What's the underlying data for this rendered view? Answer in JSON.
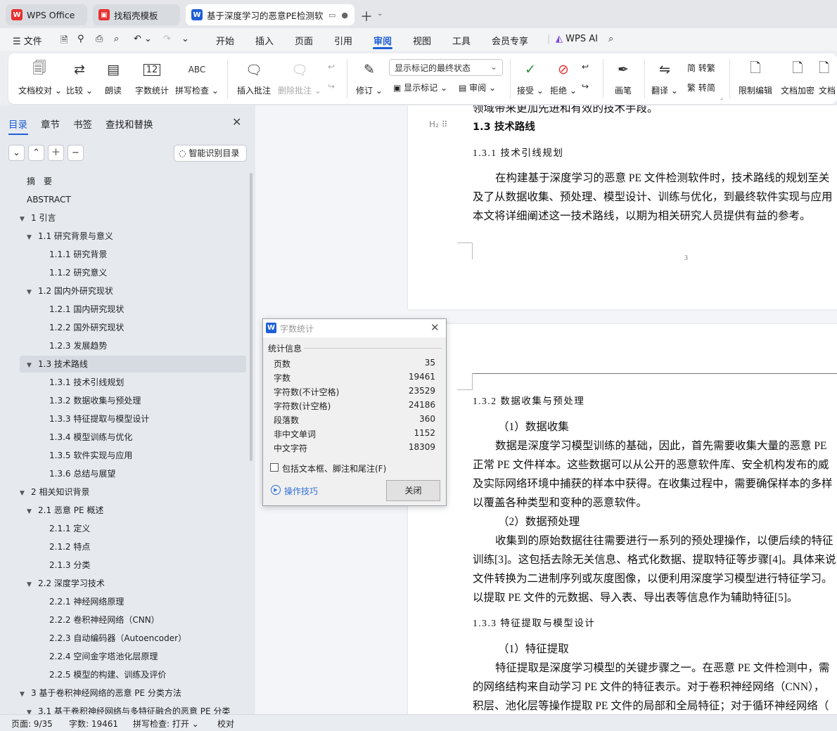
{
  "tabs": [
    {
      "label": "WPS Office"
    },
    {
      "label": "找稻壳模板"
    },
    {
      "label": "基于深度学习的恶意PE检测软"
    }
  ],
  "menu": {
    "file": "文件",
    "items": [
      "开始",
      "插入",
      "页面",
      "引用",
      "审阅",
      "视图",
      "工具",
      "会员专享"
    ],
    "active": "审阅",
    "ai": "WPS AI"
  },
  "ribbon": {
    "doc_proof": "文档校对",
    "compare": "比较",
    "read_aloud": "朗读",
    "word_count": "字数统计",
    "spell_check": "拼写检查",
    "spell_icon_text": "ABC",
    "count_icon_text": "12",
    "insert_comment": "插入批注",
    "delete_comment": "删除批注",
    "revise": "修订",
    "view_select": "显示标记的最终状态",
    "show_markup": "显示标记",
    "review": "审阅",
    "accept": "接受",
    "reject": "拒绝",
    "pen": "画笔",
    "translate": "翻译",
    "to_trad": "转繁",
    "to_simp": "转简",
    "trad_icon": "简",
    "simp_icon": "繁",
    "restrict_edit": "限制编辑",
    "encrypt": "文档加密",
    "doc_more": "文档"
  },
  "panel": {
    "tabs": [
      "目录",
      "章节",
      "书签",
      "查找和替换"
    ],
    "smart_button": "智能识别目录",
    "toc": [
      {
        "text": "摘　要",
        "level": 0,
        "toggle": ""
      },
      {
        "text": "ABSTRACT",
        "level": 0,
        "toggle": ""
      },
      {
        "text": "1  引言",
        "level": 0,
        "toggle": "▼"
      },
      {
        "text": "1.1  研究背景与意义",
        "level": 1,
        "toggle": "▼"
      },
      {
        "text": "1.1.1  研究背景",
        "level": 2,
        "toggle": ""
      },
      {
        "text": "1.1.2  研究意义",
        "level": 2,
        "toggle": ""
      },
      {
        "text": "1.2  国内外研究现状",
        "level": 1,
        "toggle": "▼"
      },
      {
        "text": "1.2.1  国内研究现状",
        "level": 2,
        "toggle": ""
      },
      {
        "text": "1.2.2 国外研究现状",
        "level": 2,
        "toggle": ""
      },
      {
        "text": "1.2.3 发展趋势",
        "level": 2,
        "toggle": ""
      },
      {
        "text": "1.3  技术路线",
        "level": 1,
        "toggle": "▼",
        "selected": true
      },
      {
        "text": "1.3.1  技术引线规划",
        "level": 2,
        "toggle": ""
      },
      {
        "text": "1.3.2  数据收集与预处理",
        "level": 2,
        "toggle": ""
      },
      {
        "text": "1.3.3  特征提取与模型设计",
        "level": 2,
        "toggle": ""
      },
      {
        "text": "1.3.4  模型训练与优化",
        "level": 2,
        "toggle": ""
      },
      {
        "text": "1.3.5  软件实现与应用",
        "level": 2,
        "toggle": ""
      },
      {
        "text": "1.3.6  总结与展望",
        "level": 2,
        "toggle": ""
      },
      {
        "text": "2  相关知识背景",
        "level": 0,
        "toggle": "▼"
      },
      {
        "text": "2.1  恶意 PE 概述",
        "level": 1,
        "toggle": "▼"
      },
      {
        "text": "2.1.1  定义",
        "level": 2,
        "toggle": ""
      },
      {
        "text": "2.1.2  特点",
        "level": 2,
        "toggle": ""
      },
      {
        "text": "2.1.3  分类",
        "level": 2,
        "toggle": ""
      },
      {
        "text": "2.2  深度学习技术",
        "level": 1,
        "toggle": "▼"
      },
      {
        "text": "2.2.1  神经网络原理",
        "level": 2,
        "toggle": ""
      },
      {
        "text": "2.2.2  卷积神经网络（CNN）",
        "level": 2,
        "toggle": ""
      },
      {
        "text": "2.2.3  自动编码器（Autoencoder）",
        "level": 2,
        "toggle": ""
      },
      {
        "text": "2.2.4  空间金字塔池化层原理",
        "level": 2,
        "toggle": ""
      },
      {
        "text": "2.2.5  模型的构建、训练及评价",
        "level": 2,
        "toggle": ""
      },
      {
        "text": "3  基于卷积神经网络的恶意 PE 分类方法",
        "level": 0,
        "toggle": "▼"
      },
      {
        "text": "3.1  基于卷积神经网络与多特征融合的恶意 PE 分类",
        "level": 1,
        "toggle": "▼"
      }
    ]
  },
  "document": {
    "page1": {
      "top_line": "领域带来更加先进和有效的技术手段。",
      "heading_mark": "H₂",
      "h13": "1.3  技术路线",
      "h131": "1.3.1 技术引线规划",
      "lines": [
        "在构建基于深度学习的恶意 PE 文件检测软件时，技术路线的规划至关",
        "及了从数据收集、预处理、模型设计、训练与优化，到最终软件实现与应用",
        "本文将详细阐述这一技术路线，以期为相关研究人员提供有益的参考。"
      ],
      "page_number": "3"
    },
    "page2": {
      "h132": "1.3.2 数据收集与预处理",
      "p1_title": "（1）数据收集",
      "p1_lines": [
        "数据是深度学习模型训练的基础，因此，首先需要收集大量的恶意 PE",
        "正常 PE 文件样本。这些数据可以从公开的恶意软件库、安全机构发布的威",
        "及实际网络环境中捕获的样本中获得。在收集过程中，需要确保样本的多样",
        "以覆盖各种类型和变种的恶意软件。"
      ],
      "p2_title": "（2）数据预处理",
      "p2_lines": [
        "收集到的原始数据往往需要进行一系列的预处理操作，以便后续的特征",
        "训练[3]。这包括去除无关信息、格式化数据、提取特征等步骤[4]。具体来说",
        "文件转换为二进制序列或灰度图像，以便利用深度学习模型进行特征学习。",
        "以提取 PE 文件的元数据、导入表、导出表等信息作为辅助特征[5]。"
      ],
      "h133": "1.3.3 特征提取与模型设计",
      "p3_title": "（1）特征提取",
      "p3_lines": [
        "特征提取是深度学习模型的关键步骤之一。在恶意 PE 文件检测中，需",
        "的网络结构来自动学习 PE 文件的特征表示。对于卷积神经网络（CNN），",
        "积层、池化层等操作提取 PE 文件的局部和全局特征；对于循环神经网络（"
      ]
    }
  },
  "dialog": {
    "title": "字数统计",
    "section": "统计信息",
    "stats": [
      {
        "label": "页数",
        "value": "35"
      },
      {
        "label": "字数",
        "value": "19461"
      },
      {
        "label": "字符数(不计空格)",
        "value": "23529"
      },
      {
        "label": "字符数(计空格)",
        "value": "24186"
      },
      {
        "label": "段落数",
        "value": "360"
      },
      {
        "label": "非中文单词",
        "value": "1152"
      },
      {
        "label": "中文字符",
        "value": "18309"
      }
    ],
    "checkbox": "包括文本框、脚注和尾注(F)",
    "tips": "操作技巧",
    "close": "关闭"
  },
  "status": {
    "page": "页面: 9/35",
    "words": "字数: 19461",
    "spell": "拼写检查: 打开",
    "proof": "校对"
  },
  "colors": {
    "accent": "#1f5fd6",
    "wps_red": "#e8312f"
  }
}
